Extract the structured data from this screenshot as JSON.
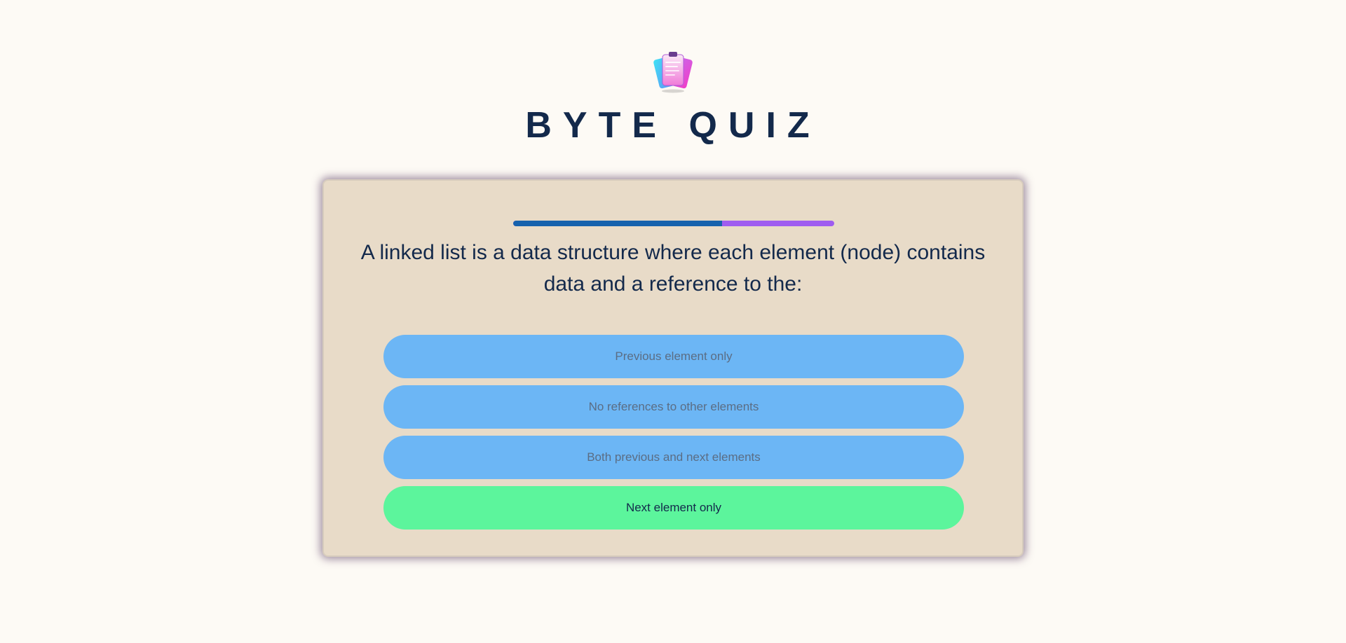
{
  "app": {
    "title": "BYTE QUIZ",
    "logo_icon": "clipboard-cards-icon"
  },
  "quiz": {
    "progress": 0.65,
    "question": "A linked list is a data structure where each element (node) contains data and a reference to the:",
    "options": [
      {
        "label": "Previous element only",
        "state": "default"
      },
      {
        "label": "No references to other elements",
        "state": "default"
      },
      {
        "label": "Both previous and next elements",
        "state": "default"
      },
      {
        "label": "Next element only",
        "state": "correct"
      }
    ]
  },
  "colors": {
    "background": "#fdfaf5",
    "title": "#13294b",
    "card": "#e8dbc8",
    "option_default": "#6cb6f5",
    "option_correct": "#5cf59c",
    "progress_fill": "#1662ad",
    "progress_track": "#9f5cf0"
  }
}
